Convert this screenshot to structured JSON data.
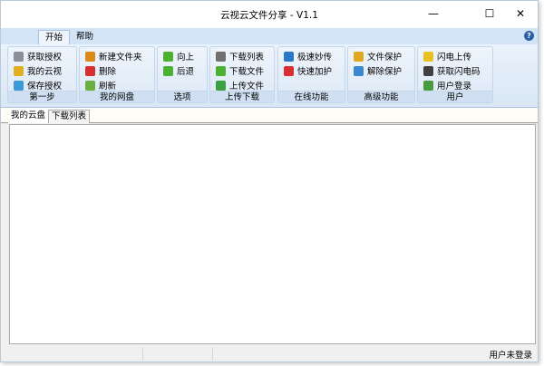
{
  "window": {
    "title": "云视云文件分享 - V1.1",
    "minimize": "—",
    "maximize": "☐",
    "close": "✕"
  },
  "ribbon_tabs": [
    {
      "label": "开始"
    },
    {
      "label": "帮助"
    }
  ],
  "help_icon": "?",
  "groups": [
    {
      "label": "第一步",
      "items": [
        {
          "label": "获取授权",
          "icon": "id-card-icon",
          "color": "#8a8f99"
        },
        {
          "label": "我的云视",
          "icon": "key-icon",
          "color": "#e0b020"
        },
        {
          "label": "保存授权",
          "icon": "cloud-icon",
          "color": "#3c9ad8"
        }
      ]
    },
    {
      "label": "我的网盘",
      "items": [
        {
          "label": "新建文件夹",
          "icon": "folder-new-icon",
          "color": "#d98a1a"
        },
        {
          "label": "删除",
          "icon": "delete-icon",
          "color": "#d83030"
        },
        {
          "label": "刷新",
          "icon": "refresh-icon",
          "color": "#6ab040"
        }
      ]
    },
    {
      "label": "选项",
      "items": [
        {
          "label": "向上",
          "icon": "arrow-up-icon",
          "color": "#4cb030"
        },
        {
          "label": "后退",
          "icon": "arrow-left-icon",
          "color": "#4cb030"
        }
      ]
    },
    {
      "label": "上传下载",
      "items": [
        {
          "label": "下载列表",
          "icon": "list-icon",
          "color": "#707070"
        },
        {
          "label": "下载文件",
          "icon": "arrow-down-icon",
          "color": "#4cb030"
        },
        {
          "label": "上传文件",
          "icon": "upload-icon",
          "color": "#3aa040"
        }
      ]
    },
    {
      "label": "在线功能",
      "items": [
        {
          "label": "极速妙传",
          "icon": "globe-icon",
          "color": "#2a78c8"
        },
        {
          "label": "快速加护",
          "icon": "lifebuoy-icon",
          "color": "#d83030"
        }
      ]
    },
    {
      "label": "高级功能",
      "items": [
        {
          "label": "文件保护",
          "icon": "lock-icon",
          "color": "#e0a820"
        },
        {
          "label": "解除保护",
          "icon": "flag-icon",
          "color": "#3a88d0"
        }
      ]
    },
    {
      "label": "用户",
      "items": [
        {
          "label": "闪电上传",
          "icon": "lightning-icon",
          "color": "#e8c020"
        },
        {
          "label": "获取闪电码",
          "icon": "binoculars-icon",
          "color": "#404040"
        },
        {
          "label": "用户登录",
          "icon": "user-icon",
          "color": "#4a9a40"
        }
      ]
    }
  ],
  "page_tabs": [
    {
      "label": "我的云盘"
    },
    {
      "label": "下载列表"
    }
  ],
  "status": {
    "text": "用户未登录"
  }
}
